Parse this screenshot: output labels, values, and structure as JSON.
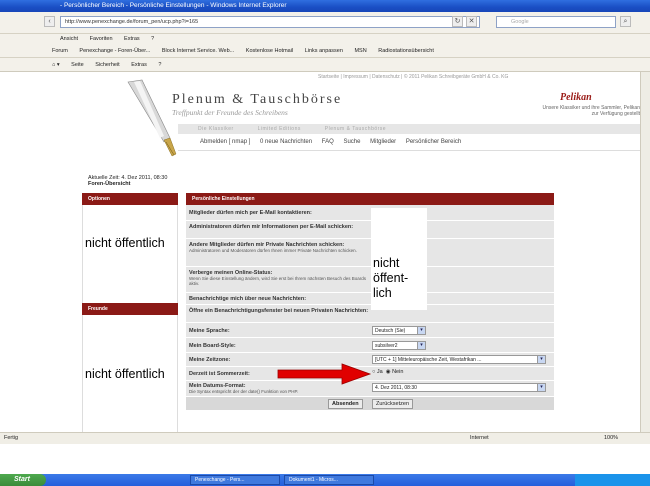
{
  "browser": {
    "title": "- Persönlicher Bereich - Persönliche Einstellungen - Windows Internet Explorer",
    "address": "http://www.penexchange.de/forum_pen/ucp.php?i=165",
    "search_placeholder": "Google",
    "menu": [
      "Ansicht",
      "Favoriten",
      "Extras",
      "?"
    ],
    "favorites": [
      "Forum",
      "Penexchange - Foren-Über...",
      "Block Internet Service. Web...",
      "Kostenlose Hotmail",
      "Links anpassen",
      "MSN",
      "Radiostationsübersicht"
    ],
    "commands": [
      "Seite",
      "Sicherheit",
      "Extras"
    ],
    "status": "Fertig",
    "zone": "Internet",
    "zoom": "100%"
  },
  "taskbar": {
    "start": "Start",
    "tasks": [
      "Penexchange - Pers...",
      "Dokument1 - Micros..."
    ]
  },
  "site": {
    "top_info": "Startseite | Impressum | Datenschutz | © 2011 Pelikan Schreibgeräte GmbH & Co. KG",
    "title": "Plenum & Tauschbörse",
    "subtitle": "Treffpunkt der Freunde des Schreibens",
    "brand": "Pelikan",
    "brand_text": "Unsere Klassiker und ihre Sammler, Pelikan zur Verfügung gestellt",
    "tabs": [
      "Die Klassiker",
      "Limited Editions",
      "Plenum & Tauschbörse"
    ],
    "nav": [
      "Abmelden [ nmap ]",
      "0 neue Nachrichten",
      "FAQ",
      "Suche",
      "Mitglieder",
      "Persönlicher Bereich"
    ],
    "time_line": "Aktuelle Zeit: 4. Dez 2011, 08:30",
    "forum_link": "Foren-Übersicht"
  },
  "sidebar": {
    "options_header": "Optionen",
    "friends_header": "Freunde",
    "overlay_text": "nicht öffentlich"
  },
  "settings": {
    "header": "Persönliche Einstellungen",
    "overlay_text_lines": [
      "nicht",
      "öffent-",
      "lich"
    ],
    "rows": [
      {
        "label": "Mitglieder dürfen mich per E-Mail kontaktieren:",
        "hint": ""
      },
      {
        "label": "Administratoren dürfen mir Informationen per E-Mail schicken:",
        "hint": ""
      },
      {
        "label": "Andere Mitglieder dürfen mir Private Nachrichten schicken:",
        "hint": "Administratoren und Moderatoren dürfen Ihnen immer Private Nachrichten schicken."
      },
      {
        "label": "Verberge meinen Online-Status:",
        "hint": "Wenn Sie diese Einstellung ändern, wird Sie erst bei Ihrem nächsten Besuch des Boards aktiv."
      },
      {
        "label": "Benachrichtige mich über neue Nachrichten:",
        "hint": ""
      },
      {
        "label": "Öffne ein Benachrichtigungsfenster bei neuen Privaten Nachrichten:",
        "hint": ""
      },
      {
        "label": "Meine Sprache:",
        "hint": ""
      },
      {
        "label": "Mein Board-Style:",
        "hint": ""
      },
      {
        "label": "Meine Zeitzone:",
        "hint": ""
      },
      {
        "label": "Derzeit ist Sommerzeit:",
        "hint": ""
      },
      {
        "label": "Mein Datums-Format:",
        "hint": "Die Syntax entspricht der der date() Funktion von PHP."
      }
    ],
    "language": "Deutsch (Sie)",
    "style": "subsilver2",
    "timezone": "[UTC + 1] Mitteleuropäische Zeit, Westafrikan ...",
    "dst_yes": "Ja",
    "dst_no": "Nein",
    "dst_value": "Nein",
    "date_format": "4. Dez 2011, 08:30",
    "submit": "Absenden",
    "reset": "Zurücksetzen"
  },
  "colors": {
    "accent": "#8b1a16",
    "arrow": "#e00000"
  }
}
